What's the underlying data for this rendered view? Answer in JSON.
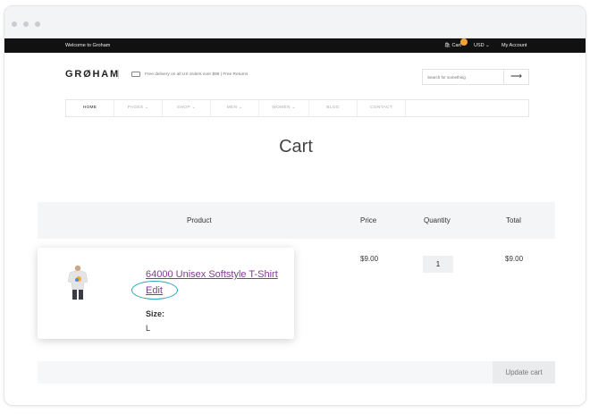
{
  "topbar": {
    "welcome": "Welcome to Groham",
    "cart": "Cart",
    "currency": "USD",
    "account": "My Account"
  },
  "header": {
    "logo": "GRØHAM",
    "promo": "Free delivery on all US orders over $99 | Free Returns",
    "search_placeholder": "Search for something",
    "search_arrow": "⟶"
  },
  "nav": {
    "items": [
      {
        "label": "HOME"
      },
      {
        "label": "PAGES ⌄"
      },
      {
        "label": "SHOP ⌄"
      },
      {
        "label": "MEN ⌄"
      },
      {
        "label": "WOMEN ⌄"
      },
      {
        "label": "BLOG"
      },
      {
        "label": "CONTACT"
      }
    ]
  },
  "page": {
    "title": "Cart"
  },
  "table": {
    "headers": {
      "product": "Product",
      "price": "Price",
      "quantity": "Quantity",
      "total": "Total"
    },
    "row": {
      "name": "64000 Unisex Softstyle T-Shirt",
      "edit": "Edit",
      "size_label": "Size:",
      "size_value": "L",
      "price": "$9.00",
      "quantity": "1",
      "total": "$9.00"
    }
  },
  "actions": {
    "update_cart": "Update cart"
  },
  "colors": {
    "accent_badge": "#f3a23a",
    "link": "#7a3f8a",
    "highlight_ring": "#2aa3b8",
    "topbar": "#111111"
  }
}
